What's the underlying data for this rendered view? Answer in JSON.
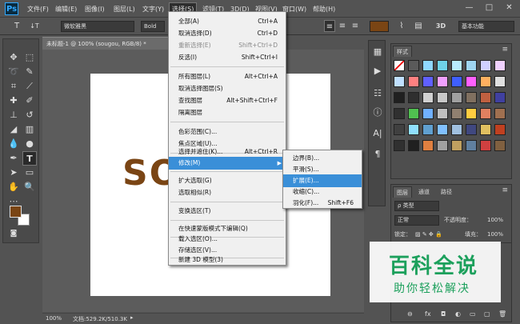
{
  "app": {
    "logo": "Ps"
  },
  "menubar": {
    "items": [
      "文件(F)",
      "编辑(E)",
      "图像(I)",
      "图层(L)",
      "文字(Y)",
      "选择(S)",
      "滤镜(T)",
      "3D(D)",
      "视图(V)",
      "窗口(W)",
      "帮助(H)"
    ],
    "active": "选择(S)"
  },
  "window_controls": {
    "minimize": "—",
    "restore": "□",
    "close": "✕"
  },
  "options_bar": {
    "tool_glyph": "T",
    "orient_glyph": "↓T",
    "font_family": "微软雅黑",
    "font_style": "Bold",
    "mode_3d": "3D",
    "workspace": "基本功能",
    "text_color": "#7a4514"
  },
  "document": {
    "tab_title": "未标题-1 @ 100% (sougou, RGB/8) *",
    "canvas_text": "SO",
    "zoom": "100%",
    "doc_info": "文档:529.2K/510.3K"
  },
  "tools": {
    "foreground": "#7a4514",
    "background": "#ffffff"
  },
  "styles_panel": {
    "tab": "样式"
  },
  "layers_panel": {
    "tabs": [
      "图层",
      "通道",
      "路径"
    ],
    "filter_label": "ρ 类型",
    "blend_mode": "正常",
    "opacity_label": "不透明度：",
    "opacity_value": "100%",
    "lock_label": "锁定：",
    "fill_label": "填充：",
    "fill_value": "100%",
    "footer_icons": [
      "⊖",
      "fx",
      "◘",
      "◐",
      "▭",
      "▢",
      "🗑"
    ]
  },
  "select_menu": {
    "items": [
      {
        "label": "全部(A)",
        "shortcut": "Ctrl+A",
        "disabled": false
      },
      {
        "label": "取消选择(D)",
        "shortcut": "Ctrl+D",
        "disabled": false
      },
      {
        "label": "重新选择(E)",
        "shortcut": "Shift+Ctrl+D",
        "disabled": true
      },
      {
        "label": "反选(I)",
        "shortcut": "Shift+Ctrl+I",
        "disabled": false
      },
      {
        "label": "所有图层(L)",
        "shortcut": "Alt+Ctrl+A",
        "disabled": false
      },
      {
        "label": "取消选择图层(S)",
        "shortcut": "",
        "disabled": false
      },
      {
        "label": "查找图层",
        "shortcut": "Alt+Shift+Ctrl+F",
        "disabled": false
      },
      {
        "label": "隔离图层",
        "shortcut": "",
        "disabled": false
      },
      {
        "label": "色彩范围(C)...",
        "shortcut": "",
        "disabled": false
      },
      {
        "label": "焦点区域(U)...",
        "shortcut": "",
        "disabled": false
      },
      {
        "label": "选择并遮住(K)...",
        "shortcut": "Alt+Ctrl+R",
        "disabled": false
      },
      {
        "label": "修改(M)",
        "shortcut": "",
        "disabled": false
      },
      {
        "label": "扩大选取(G)",
        "shortcut": "",
        "disabled": false
      },
      {
        "label": "选取相似(R)",
        "shortcut": "",
        "disabled": false
      },
      {
        "label": "变换选区(T)",
        "shortcut": "",
        "disabled": false
      },
      {
        "label": "在快速蒙版模式下编辑(Q)",
        "shortcut": "",
        "disabled": false
      },
      {
        "label": "载入选区(O)...",
        "shortcut": "",
        "disabled": false
      },
      {
        "label": "存储选区(V)...",
        "shortcut": "",
        "disabled": false
      },
      {
        "label": "新建 3D 模型(3)",
        "shortcut": "",
        "disabled": false
      }
    ]
  },
  "modify_submenu": {
    "items": [
      {
        "label": "边界(B)...",
        "shortcut": ""
      },
      {
        "label": "平滑(S)...",
        "shortcut": ""
      },
      {
        "label": "扩展(E)...",
        "shortcut": ""
      },
      {
        "label": "收缩(C)...",
        "shortcut": ""
      },
      {
        "label": "羽化(F)...",
        "shortcut": "Shift+F6"
      }
    ],
    "highlighted": "扩展(E)..."
  },
  "watermark": {
    "main": "百科全说",
    "sub": "助你轻松解决"
  }
}
